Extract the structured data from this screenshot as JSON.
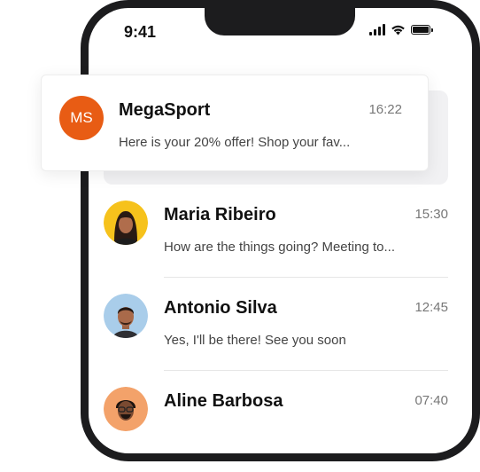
{
  "status_bar": {
    "time": "9:41"
  },
  "notification": {
    "avatar_initials": "MS",
    "avatar_color": "#e85c14",
    "name": "MegaSport",
    "time": "16:22",
    "preview": "Here is your 20% offer! Shop your fav..."
  },
  "chats": [
    {
      "name": "Maria Ribeiro",
      "time": "15:30",
      "preview": "How are the things going? Meeting to...",
      "avatar_bg": "#f6c21c"
    },
    {
      "name": "Antonio Silva",
      "time": "12:45",
      "preview": "Yes, I'll be there! See you soon",
      "avatar_bg": "#a9cdea"
    },
    {
      "name": "Aline Barbosa",
      "time": "07:40",
      "preview": "",
      "avatar_bg": "#f3a26a"
    }
  ]
}
